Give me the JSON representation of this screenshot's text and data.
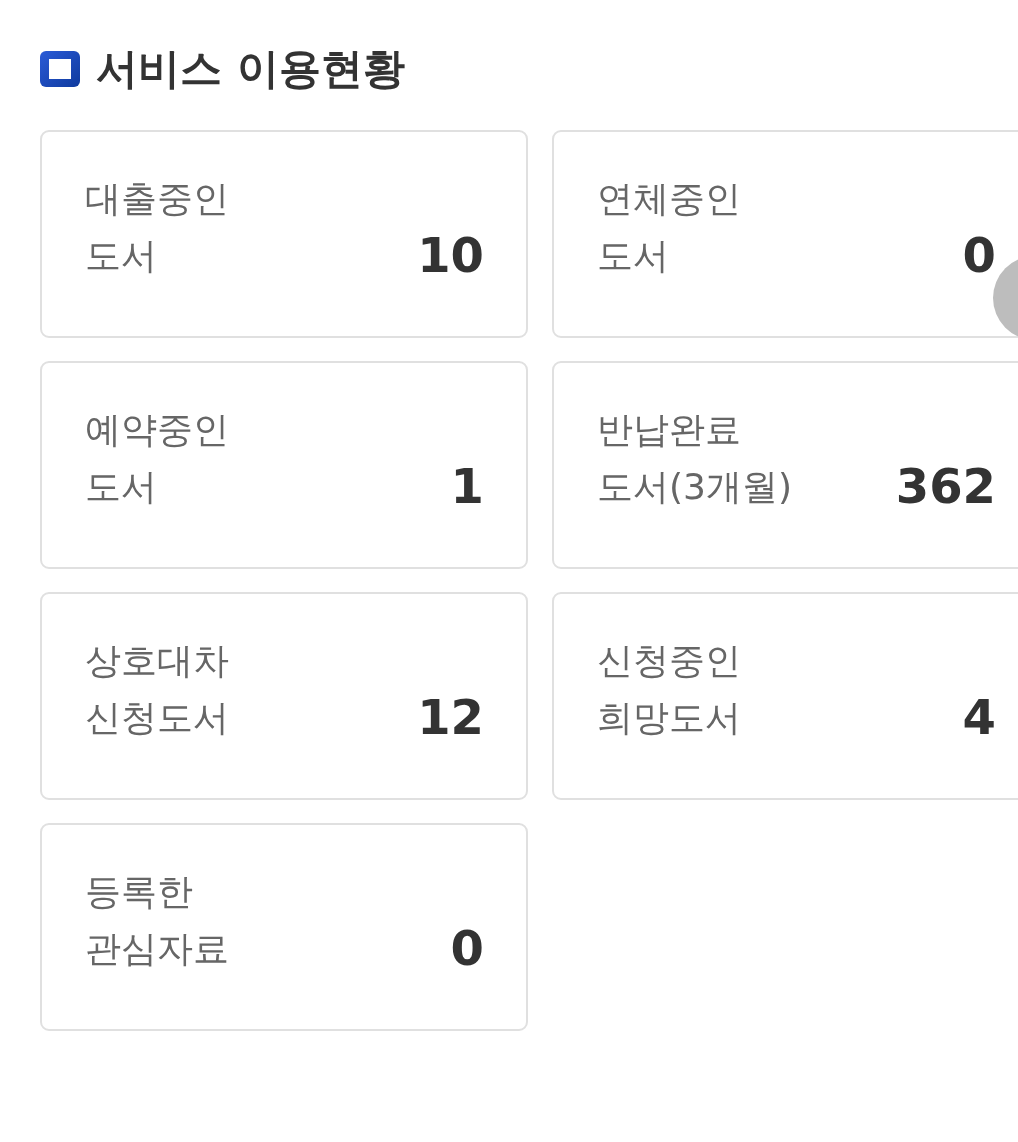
{
  "heading": {
    "title": "서비스 이용현황"
  },
  "cards": [
    {
      "label": "대출중인\n도서",
      "value": "10"
    },
    {
      "label": "연체중인\n도서",
      "value": "0"
    },
    {
      "label": "예약중인\n도서",
      "value": "1"
    },
    {
      "label": "반납완료\n도서(3개월)",
      "value": "362"
    },
    {
      "label": "상호대차\n신청도서",
      "value": "12"
    },
    {
      "label": "신청중인\n희망도서",
      "value": "4"
    },
    {
      "label": "등록한\n관심자료",
      "value": "0"
    }
  ]
}
